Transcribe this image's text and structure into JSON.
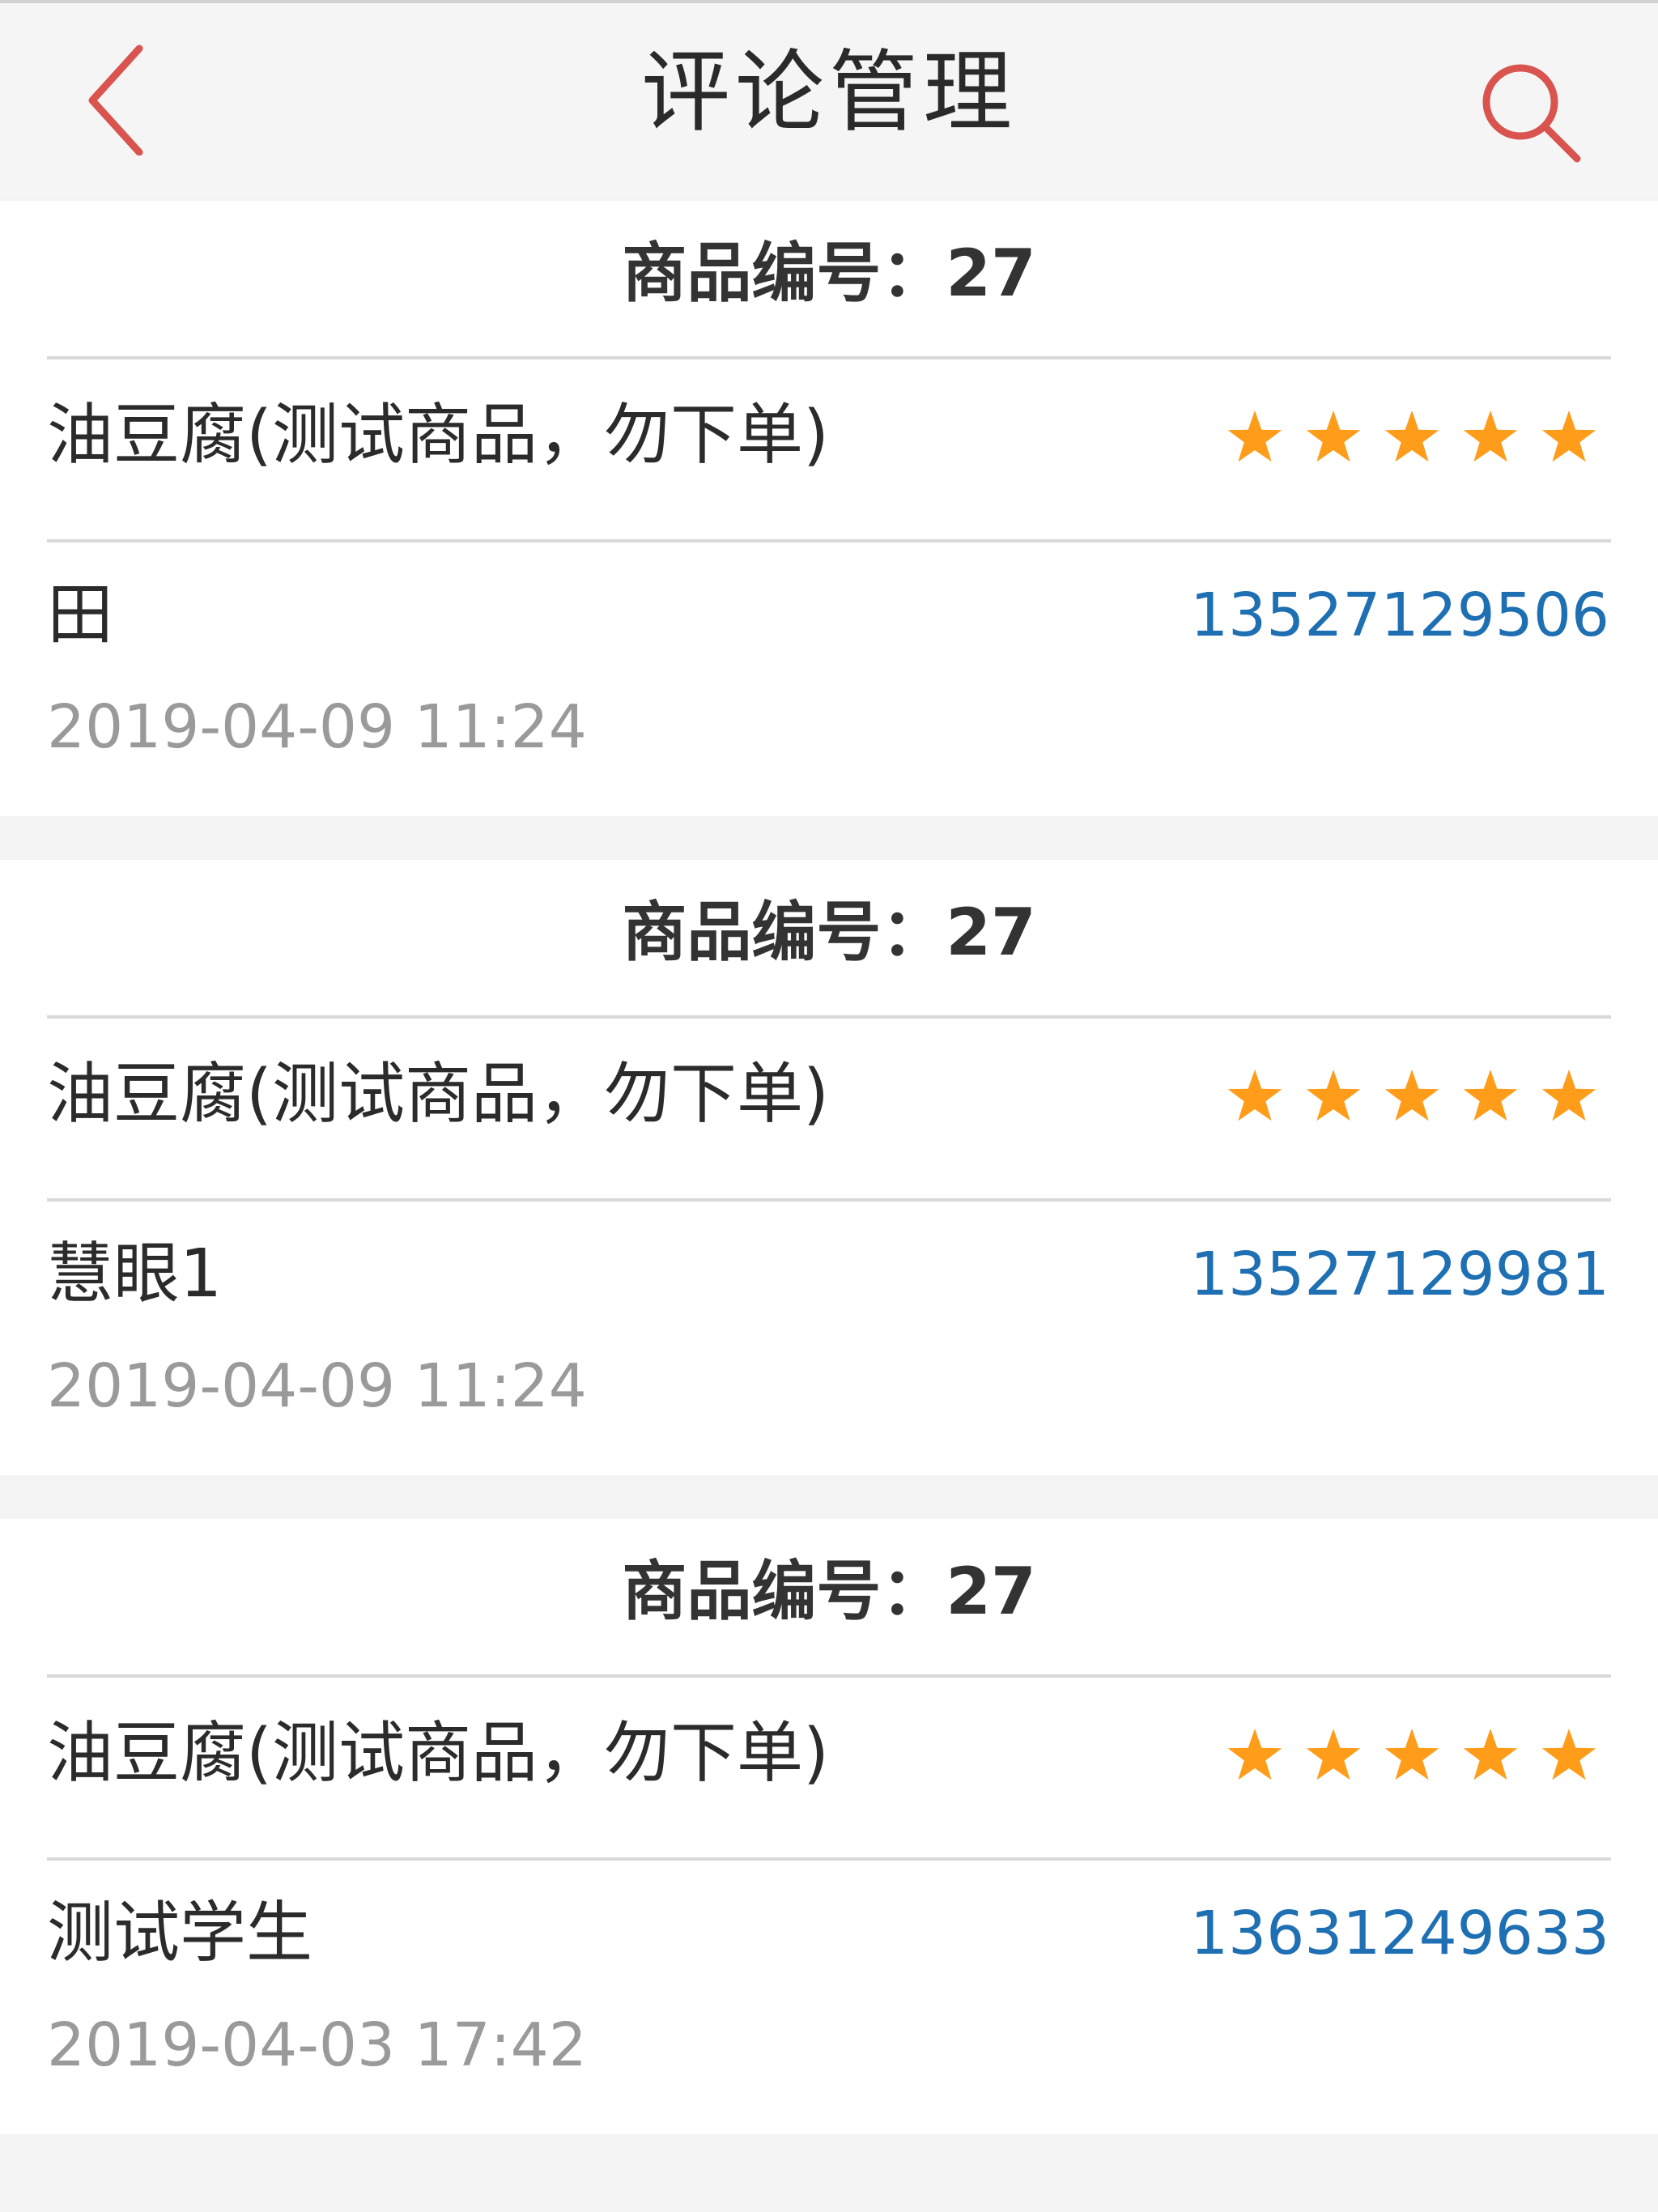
{
  "header": {
    "title": "评论管理",
    "back_icon": "chevron-left-icon",
    "search_icon": "search-icon",
    "accent_color": "#d9534f"
  },
  "reviews": [
    {
      "product_id_label": "商品编号：27",
      "product_name": "油豆腐(测试商品，勿下单)",
      "rating": 5,
      "reviewer": "田",
      "phone": "13527129506",
      "time": "2019-04-09 11:24"
    },
    {
      "product_id_label": "商品编号：27",
      "product_name": "油豆腐(测试商品，勿下单)",
      "rating": 5,
      "reviewer": "慧眼1",
      "phone": "13527129981",
      "time": "2019-04-09 11:24"
    },
    {
      "product_id_label": "商品编号：27",
      "product_name": "油豆腐(测试商品，勿下单)",
      "rating": 5,
      "reviewer": "测试学生",
      "phone": "13631249633",
      "time": "2019-04-03 17:42"
    }
  ],
  "colors": {
    "star": "#ff9c1a",
    "phone": "#1f6fb3",
    "muted": "#9a9a9a"
  }
}
